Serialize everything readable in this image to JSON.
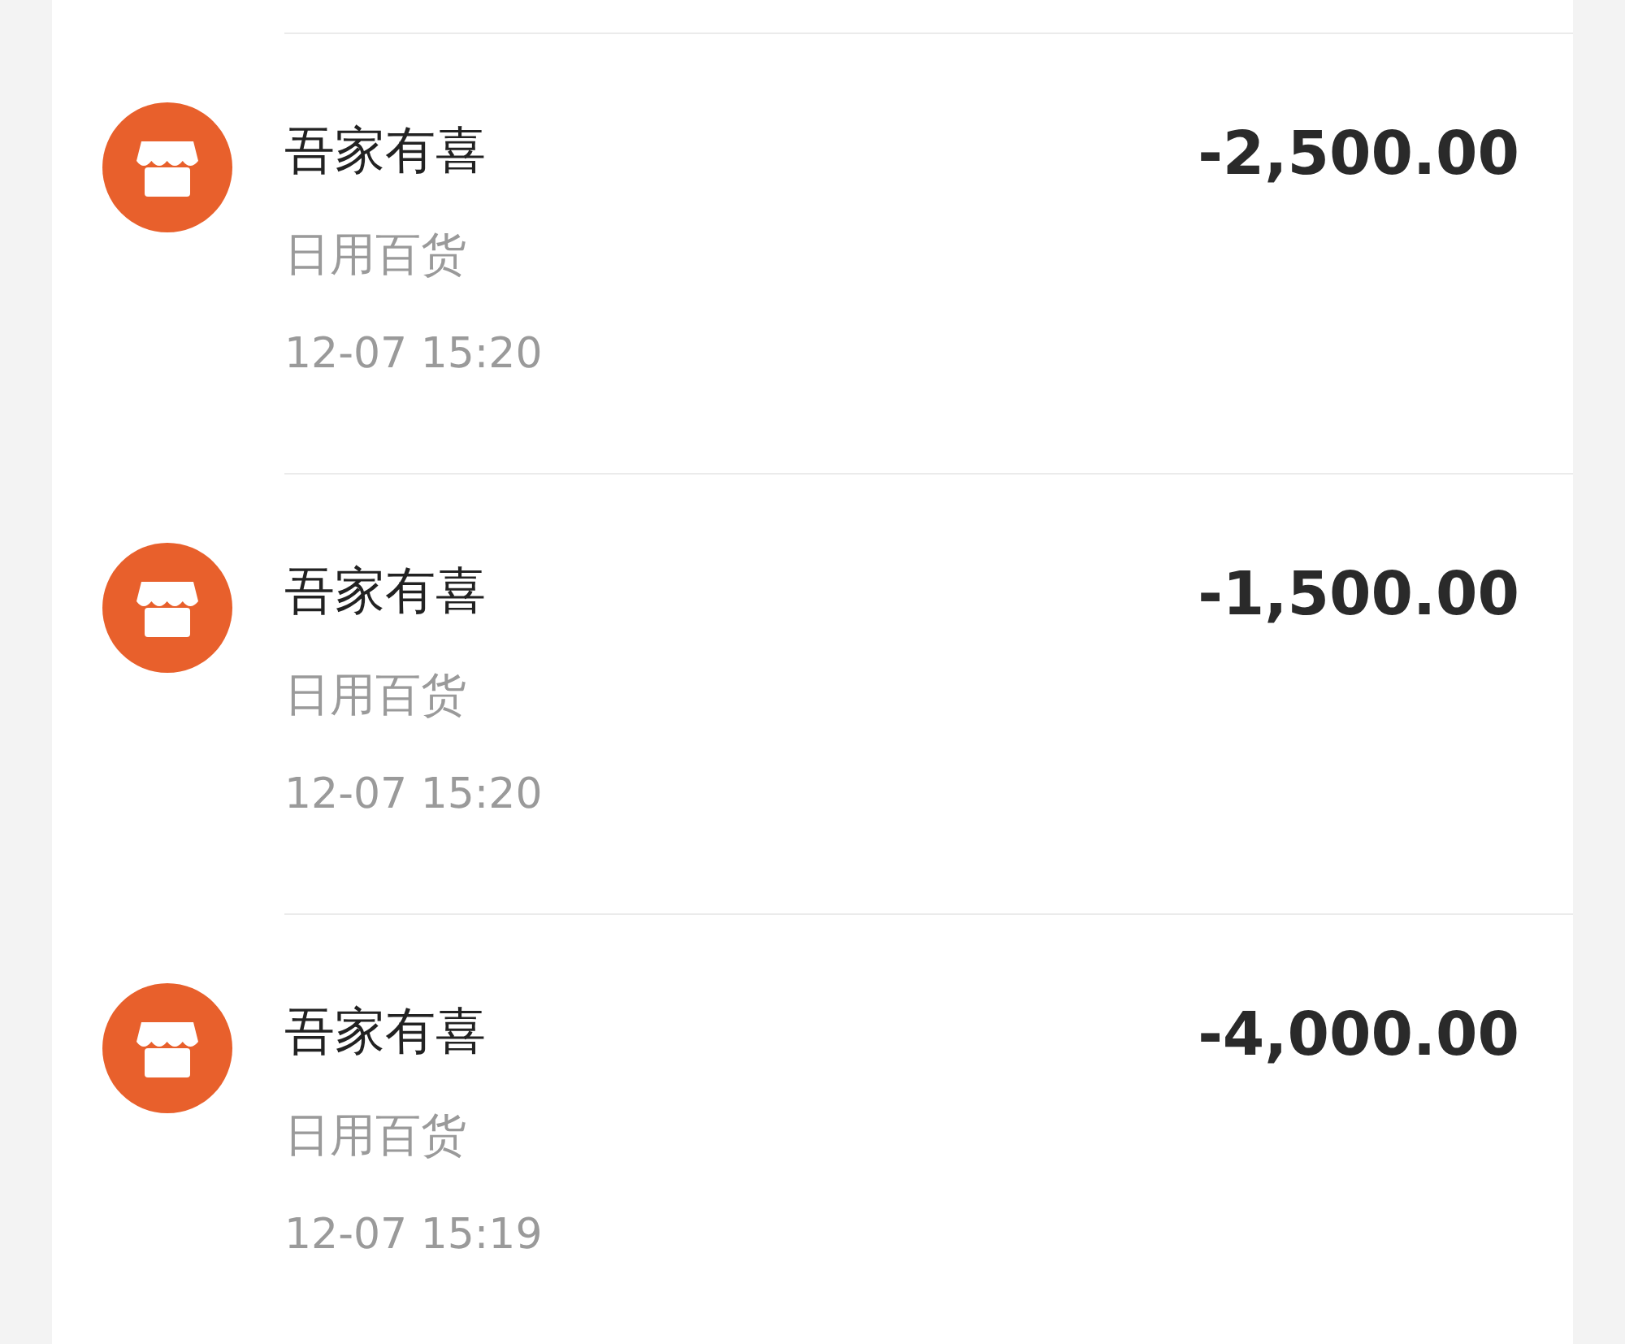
{
  "transactions": [
    {
      "merchant": "吾家有喜",
      "category": "日用百货",
      "time": "12-07 15:20",
      "amount": "-2,500.00"
    },
    {
      "merchant": "吾家有喜",
      "category": "日用百货",
      "time": "12-07 15:20",
      "amount": "-1,500.00"
    },
    {
      "merchant": "吾家有喜",
      "category": "日用百货",
      "time": "12-07 15:19",
      "amount": "-4,000.00"
    }
  ]
}
